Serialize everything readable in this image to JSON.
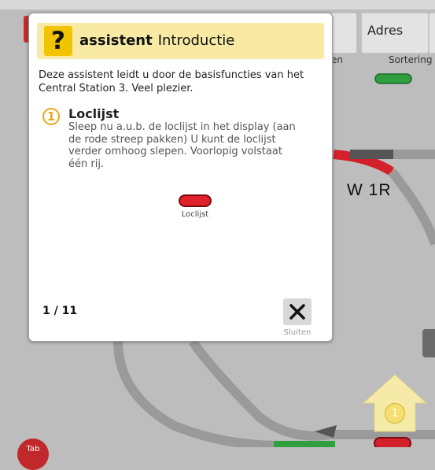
{
  "background": {
    "tab_adres": {
      "label": "Adres",
      "sub": "Sortering"
    },
    "tab_left_sub": "en",
    "turnout_label": "W 1R",
    "marker_number": "1",
    "loco_button_text": "Tab"
  },
  "dialog": {
    "icon": "?",
    "title_bold": "assistent",
    "title_rest": "Introductie",
    "intro": "Deze assistent leidt u door de basisfuncties van het Central Station 3. Veel plezier.",
    "step": {
      "number": "1",
      "title": "Loclijst",
      "text": "Sleep nu a.u.b. de loclijst in het display (aan de rode streep pakken) U kunt de loclijst verder omhoog slepen. Voorlopig volstaat één rij."
    },
    "demo_label": "Loclijst",
    "page_counter": "1 / 11",
    "close_label": "Sluiten"
  },
  "colors": {
    "header_bg": "#f8eaa4",
    "question_icon": "#f2c400",
    "step_ring": "#e7a91a",
    "track": "#9a9a9a",
    "turnout_red": "#d4202a",
    "signal_green": "#2e9e3e",
    "arrow_yellow": "#f6eaa8"
  }
}
